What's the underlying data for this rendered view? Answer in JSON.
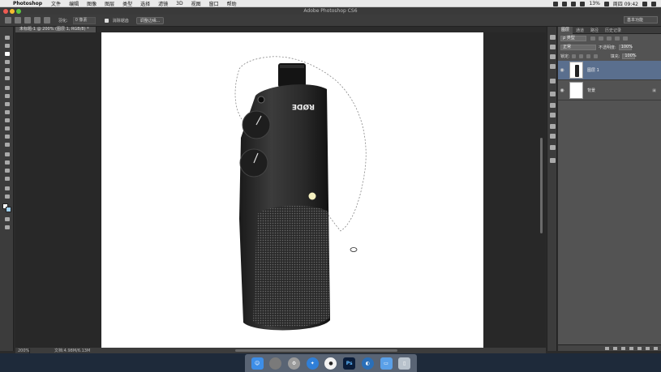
{
  "menubar": {
    "app": "Photoshop",
    "items": [
      "文件",
      "编辑",
      "图像",
      "图层",
      "类型",
      "选择",
      "滤镜",
      "3D",
      "视图",
      "窗口",
      "帮助"
    ],
    "battery": "13%",
    "clock": "周四 09:42"
  },
  "window": {
    "title": "Adobe Photoshop CS6"
  },
  "options": {
    "feather_label": "羽化:",
    "feather_value": "0 像素",
    "antialias_label": "消除锯齿",
    "refine_button": "调整边缘...",
    "workspace": "基本功能"
  },
  "document": {
    "tab": "未标题-1 @ 200% (图层 1, RGB/8) *"
  },
  "status": {
    "zoom": "200%",
    "doc_size": "文档:4.98M/6.13M"
  },
  "layers_panel": {
    "tabs": [
      "图层",
      "通道",
      "路径",
      "历史记录"
    ],
    "kind_label": "ρ 类型",
    "blend_mode": "正常",
    "opacity_label": "不透明度:",
    "opacity_value": "100%",
    "lock_label": "锁定:",
    "fill_label": "填充:",
    "fill_value": "100%",
    "layers": [
      {
        "name": "图层 1",
        "selected": true
      },
      {
        "name": "背景",
        "selected": false
      }
    ]
  },
  "product": {
    "brand_text": "RØDE"
  },
  "colors": {
    "selected_layer": "#5a6f8e",
    "canvas": "#ffffff",
    "ps_blue": "#0b1d3a"
  }
}
